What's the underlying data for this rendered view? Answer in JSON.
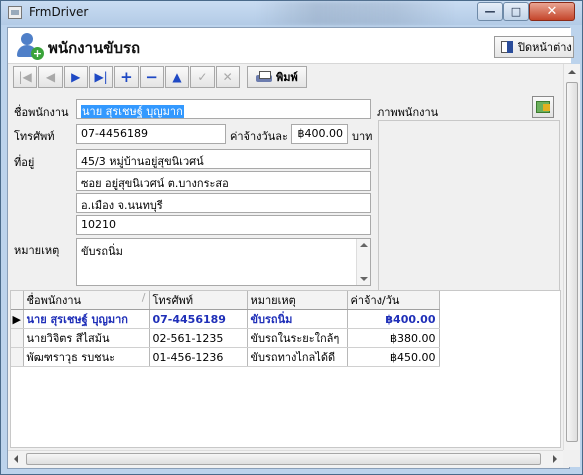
{
  "window": {
    "title": "FrmDriver",
    "min_glyph": "—",
    "max_glyph": "□",
    "close_glyph": "✕"
  },
  "header": {
    "title": "พนักงานขับรถ",
    "close_button": "ปิดหน้าต่าง"
  },
  "toolbar": {
    "buttons": [
      {
        "name": "first-record-button",
        "glyph": "|◀",
        "enabled": false
      },
      {
        "name": "prev-record-button",
        "glyph": "◀",
        "enabled": false
      },
      {
        "name": "next-record-button",
        "glyph": "▶",
        "enabled": true
      },
      {
        "name": "last-record-button",
        "glyph": "▶|",
        "enabled": true
      },
      {
        "name": "add-record-button",
        "glyph": "+",
        "enabled": true
      },
      {
        "name": "delete-record-button",
        "glyph": "−",
        "enabled": true
      },
      {
        "name": "edit-record-button",
        "glyph": "▲",
        "enabled": true
      },
      {
        "name": "post-record-button",
        "glyph": "✓",
        "enabled": false
      },
      {
        "name": "cancel-record-button",
        "glyph": "✕",
        "enabled": false
      }
    ],
    "print_label": "พิมพ์"
  },
  "form": {
    "name_label": "ชื่อพนักงาน",
    "name_value": "นาย สุรเชษฐ์ บุญมาก",
    "phone_label": "โทรศัพท์",
    "phone_value": "07-4456189",
    "wage_label": "ค่าจ้างวันละ",
    "wage_value": "฿400.00",
    "wage_unit": "บาท",
    "address_label": "ที่อยู่",
    "address_line1": "45/3 หมู่บ้านอยู่สุขนิเวศน์",
    "address_line2": "ซอย อยู่สุขนิเวศน์ ต.บางกระสอ",
    "address_line3": "อ.เมือง จ.นนทบุรี",
    "address_line4": "10210",
    "note_label": "หมายเหตุ",
    "note_value": "ขับรถนิ่ม",
    "photo_label": "ภาพพนักงาน"
  },
  "grid": {
    "columns": [
      "ชื่อพนักงาน",
      "โทรศัพท์",
      "หมายเหตุ",
      "ค่าจ้าง/วัน"
    ],
    "current_marker": "▶",
    "rows": [
      {
        "name": "นาย สุรเชษฐ์ บุญมาก",
        "phone": "07-4456189",
        "note": "ขับรถนิ่ม",
        "wage": "฿400.00"
      },
      {
        "name": "นายวิจิตร สีไสม้น",
        "phone": "02-561-1235",
        "note": "ขับรถในระยะใกล้ๆ",
        "wage": "฿380.00"
      },
      {
        "name": "พัฒฑราวุธ รบชนะ",
        "phone": "01-456-1236",
        "note": "ขับรถทางไกลได้ดี",
        "wage": "฿450.00"
      }
    ]
  }
}
